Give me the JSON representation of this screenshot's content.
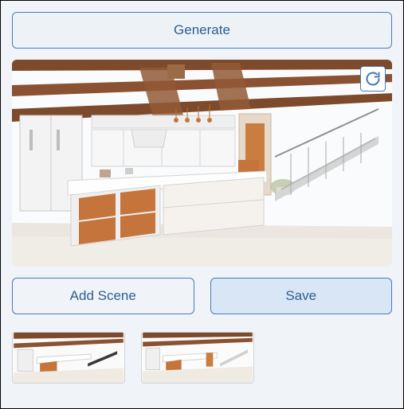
{
  "buttons": {
    "generate": "Generate",
    "add_scene": "Add Scene",
    "save": "Save"
  },
  "icons": {
    "refresh": "refresh-icon"
  },
  "canvas": {
    "description": "watercolor kitchen interior with island, wood beams, stairs"
  },
  "thumbnails": [
    {
      "description": "kitchen view angle 1"
    },
    {
      "description": "kitchen view angle 2"
    }
  ]
}
